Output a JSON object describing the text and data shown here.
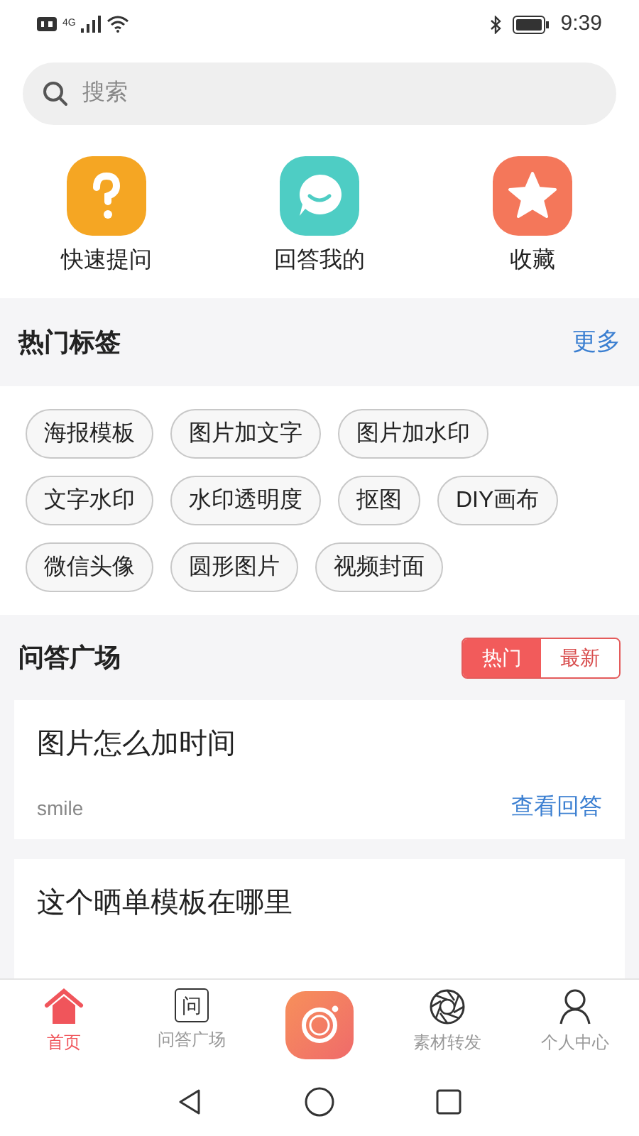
{
  "status_bar": {
    "time": "9:39",
    "network": "4G"
  },
  "search": {
    "placeholder": "搜索"
  },
  "shortcuts": [
    {
      "label": "快速提问",
      "kind": "question",
      "color": "#f5a623"
    },
    {
      "label": "回答我的",
      "kind": "chat",
      "color": "#4ecdc4"
    },
    {
      "label": "收藏",
      "kind": "star",
      "color": "#f4775a"
    }
  ],
  "hot_tags": {
    "title": "热门标签",
    "more": "更多",
    "tags": [
      "海报模板",
      "图片加文字",
      "图片加水印",
      "文字水印",
      "水印透明度",
      "抠图",
      "DIY画布",
      "微信头像",
      "圆形图片",
      "视频封面"
    ]
  },
  "qa": {
    "title": "问答广场",
    "tabs": [
      {
        "label": "热门",
        "selected": true
      },
      {
        "label": "最新",
        "selected": false
      }
    ],
    "posts": [
      {
        "title": "图片怎么加时间",
        "author": "smile",
        "link": "查看回答"
      },
      {
        "title": "这个晒单模板在哪里"
      }
    ]
  },
  "bottom_nav": [
    {
      "label": "首页",
      "kind": "home",
      "selected": true
    },
    {
      "label": "问答广场",
      "kind": "qa",
      "icon_text": "问",
      "selected": false
    },
    {
      "kind": "camera"
    },
    {
      "label": "素材转发",
      "kind": "aperture",
      "selected": false
    },
    {
      "label": "个人中心",
      "kind": "person",
      "selected": false
    }
  ]
}
